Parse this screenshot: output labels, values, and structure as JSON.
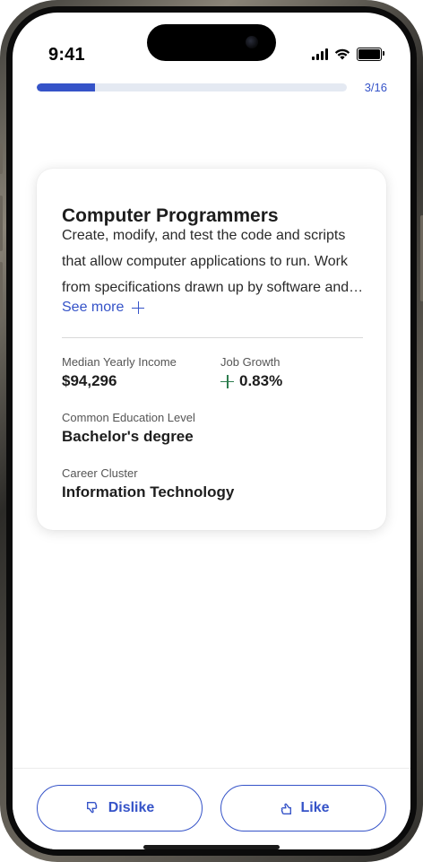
{
  "status_bar": {
    "time": "9:41"
  },
  "progress": {
    "current": 3,
    "total": 16,
    "label": "3/16",
    "fraction": 0.1875
  },
  "card": {
    "title": "Computer Programmers",
    "description_lines": [
      "Create, modify, and test the code and scripts",
      "that allow computer applications to run. Work",
      "from specifications drawn up by software and…"
    ],
    "see_more_label": "See more",
    "stats": {
      "median_income": {
        "label": "Median Yearly Income",
        "value": "$94,296"
      },
      "job_growth": {
        "label": "Job Growth",
        "value": "0.83%"
      },
      "education": {
        "label": "Common Education Level",
        "value": "Bachelor's degree"
      },
      "career_cluster": {
        "label": "Career Cluster",
        "value": "Information Technology"
      }
    }
  },
  "actions": {
    "dislike_label": "Dislike",
    "like_label": "Like",
    "dislike_icon": "thumbs-down-icon",
    "like_icon": "thumbs-up-icon"
  },
  "colors": {
    "accent": "#3553c8",
    "growth": "#2e7d4f",
    "track": "#e4e9f2"
  }
}
